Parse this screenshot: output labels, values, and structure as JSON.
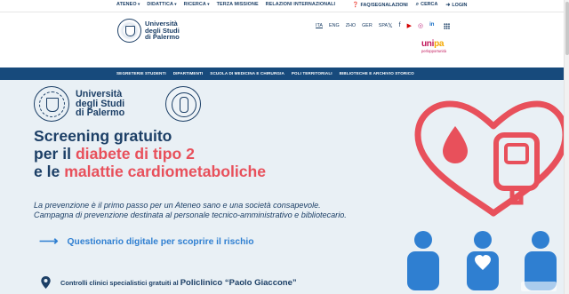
{
  "topbar": {
    "menu": [
      "ATENEO",
      "DIDATTICA",
      "RICERCA",
      "TERZA MISSIONE",
      "RELAZIONI INTERNAZIONALI"
    ],
    "faq": "FAQ/SEGNALAZIONI",
    "search": "CERCA",
    "login": "LOGIN"
  },
  "header": {
    "logo_line1": "Università",
    "logo_line2": "degli Studi",
    "logo_line3": "di Palermo",
    "languages": [
      "ITA",
      "ENG",
      "ZHO",
      "GER",
      "SPA"
    ],
    "socials": [
      "x-icon",
      "facebook-icon",
      "youtube-icon",
      "instagram-icon",
      "linkedin-icon"
    ],
    "unipa_word_a": "uni",
    "unipa_word_b": "pa",
    "unipa_tagline": "perlopportunità"
  },
  "navbar": {
    "items": [
      "SEGRETERIE STUDENTI",
      "DIPARTIMENTI",
      "SCUOLA DI MEDICINA E CHIRURGIA",
      "POLI TERRITORIALI",
      "BIBLIOTECHE E ARCHIVIO STORICO"
    ]
  },
  "hero": {
    "logo_line1": "Università",
    "logo_line2": "degli Studi",
    "logo_line3": "di Palermo",
    "headline_1": "Screening gratuito",
    "headline_2a": "per il ",
    "headline_2b": "diabete di tipo 2",
    "headline_3a": "e le ",
    "headline_3b": "malattie cardiometaboliche",
    "subtitle_1": "La prevenzione è il primo passo per un Ateneo sano e una società consapevole.",
    "subtitle_2": "Campagna di prevenzione destinata al personale tecnico-amministrativo e bibliotecario.",
    "cta_label": "Questionario digitale per scoprire il rischio",
    "clinic_prefix": "Controlli clinici specialistici gratuiti al ",
    "clinic_name": "Policlinico “Paolo Giaccone”"
  },
  "colors": {
    "navy": "#1c3f66",
    "nav_bar": "#174a7c",
    "accent_red": "#e8505b",
    "accent_blue": "#2f7fd1",
    "hero_bg": "#e9f0f5"
  }
}
